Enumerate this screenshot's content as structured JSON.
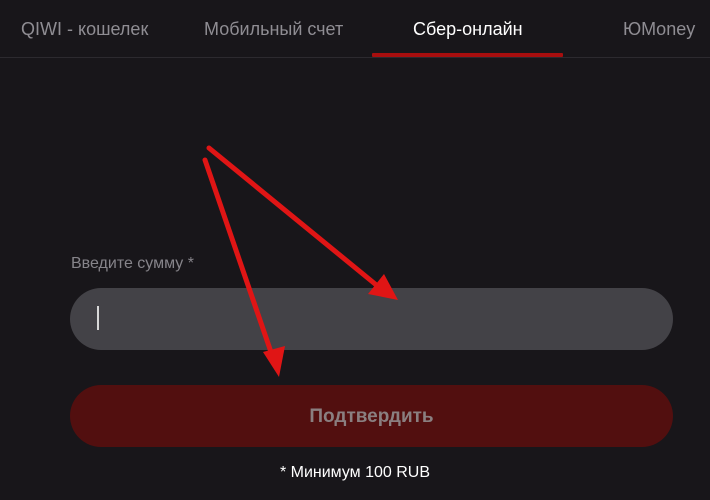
{
  "tabs": [
    {
      "label": "QIWI - кошелек",
      "active": false
    },
    {
      "label": "Мобильный счет",
      "active": false
    },
    {
      "label": "Сбер-онлайн",
      "active": true
    },
    {
      "label": "ЮMoney",
      "active": false
    }
  ],
  "form": {
    "amount_label": "Введите сумму *",
    "amount_value": "",
    "submit_label": "Подтвердить",
    "min_note": "* Минимум 100 RUB"
  },
  "colors": {
    "background": "#18161a",
    "accent": "#a70e0e",
    "input_bg": "#434247",
    "button_bg": "#520f0f",
    "annotation_arrow": "#e01515"
  }
}
